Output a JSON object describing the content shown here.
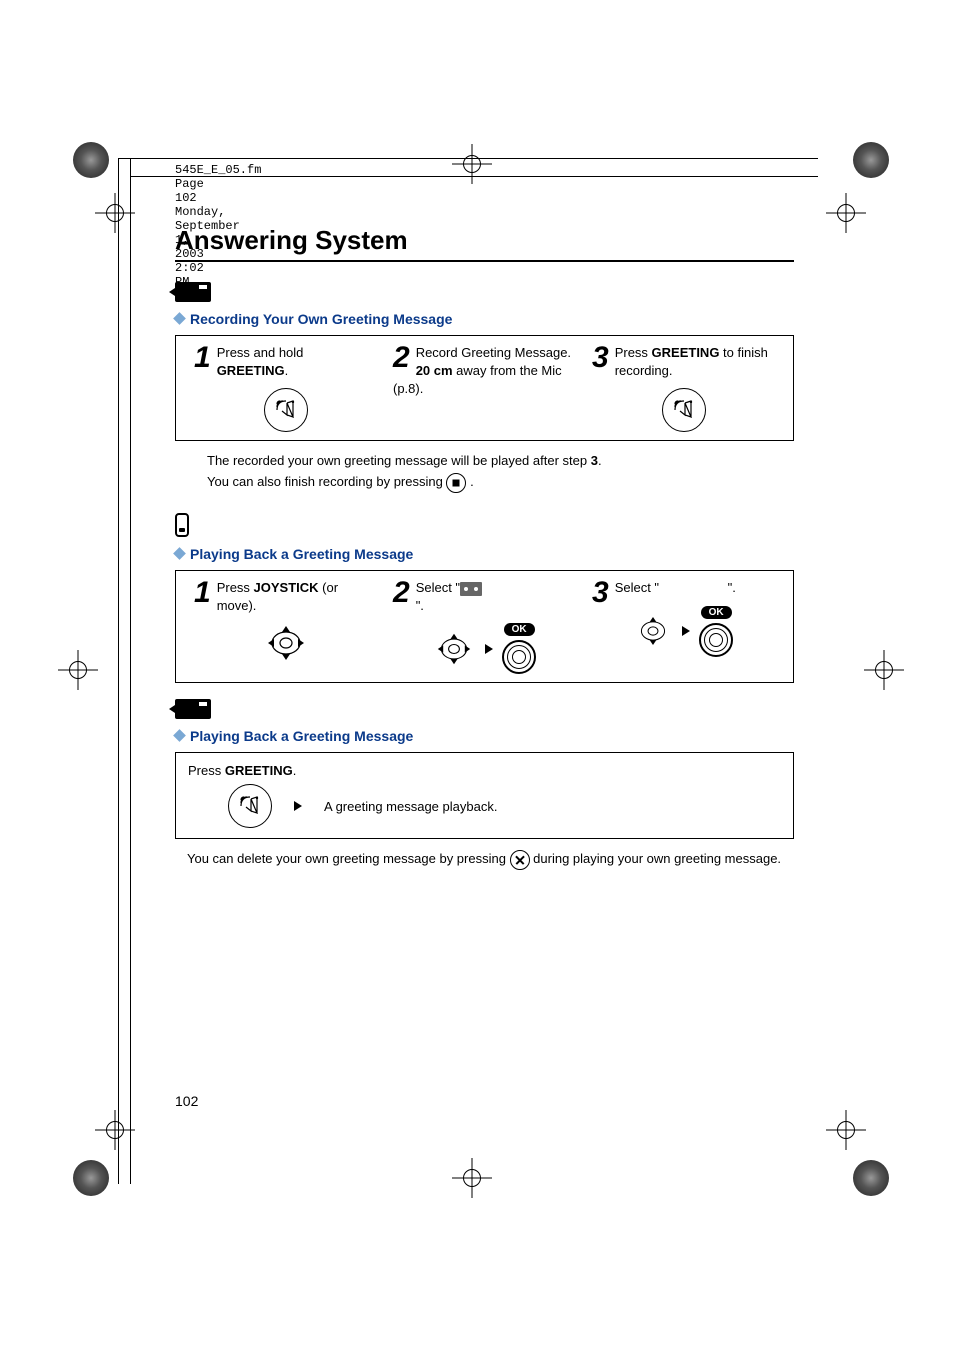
{
  "header_line": "545E_E_05.fm  Page 102  Monday, September 1, 2003  2:02 PM",
  "title": "Answering System",
  "section1": {
    "heading": "Recording Your Own Greeting Message",
    "step1_a": "Press and hold ",
    "step1_b": "GREETING",
    "step1_c": ".",
    "step2_a": "Record Greeting Message. ",
    "step2_b": "20 cm",
    "step2_c": " away from the Mic (p.8).",
    "step3_a": "Press ",
    "step3_b": "GREETING",
    "step3_c": " to finish recording.",
    "note1_a": "The recorded your own greeting message will be played after step ",
    "note1_b": "3",
    "note1_c": ".",
    "note2": "You can also finish recording by pressing ",
    "note2_end": " ."
  },
  "section2": {
    "heading": "Playing Back a Greeting Message",
    "step1_a": "Press ",
    "step1_b": "JOYSTICK",
    "step1_c": " (or move).",
    "step2_a": "Select \"",
    "step2_b": "\".",
    "step3_a": "Select \"",
    "step3_b": "\".",
    "ok": "OK"
  },
  "section3": {
    "heading": "Playing Back a Greeting Message",
    "press_a": "Press ",
    "press_b": "GREETING",
    "press_c": ".",
    "result": "A greeting message playback.",
    "note_a": "You can delete your own greeting message by pressing ",
    "note_b": " during playing your own greeting message."
  },
  "page": "102"
}
